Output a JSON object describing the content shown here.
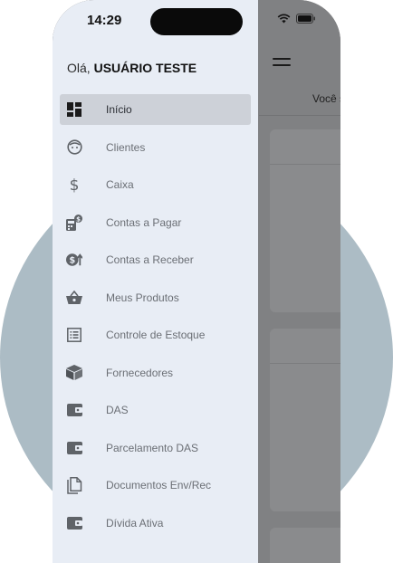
{
  "status_bar": {
    "time": "14:29"
  },
  "drawer": {
    "greeting_prefix": "Olá, ",
    "user_name": "USUÁRIO TESTE",
    "items": [
      {
        "label": "Início",
        "icon": "dashboard-icon",
        "active": true
      },
      {
        "label": "Clientes",
        "icon": "face-icon"
      },
      {
        "label": "Caixa",
        "icon": "dollar-icon"
      },
      {
        "label": "Contas a Pagar",
        "icon": "calculator-dollar-icon"
      },
      {
        "label": "Contas a Receber",
        "icon": "money-arrow-up-icon"
      },
      {
        "label": "Meus Produtos",
        "icon": "basket-icon"
      },
      {
        "label": "Controle de Estoque",
        "icon": "list-icon"
      },
      {
        "label": "Fornecedores",
        "icon": "box-icon"
      },
      {
        "label": "DAS",
        "icon": "wallet-icon"
      },
      {
        "label": "Parcelamento DAS",
        "icon": "wallet-icon"
      },
      {
        "label": "Documentos Env/Rec",
        "icon": "documents-icon"
      },
      {
        "label": "Dívida Ativa",
        "icon": "wallet-icon"
      }
    ]
  },
  "background_app": {
    "greeting": "Você s"
  },
  "colors": {
    "drawer_bg": "#e8edf5",
    "active_item": "#cdd1d8",
    "overlay": "#808183",
    "circle": "#acbcc5"
  }
}
